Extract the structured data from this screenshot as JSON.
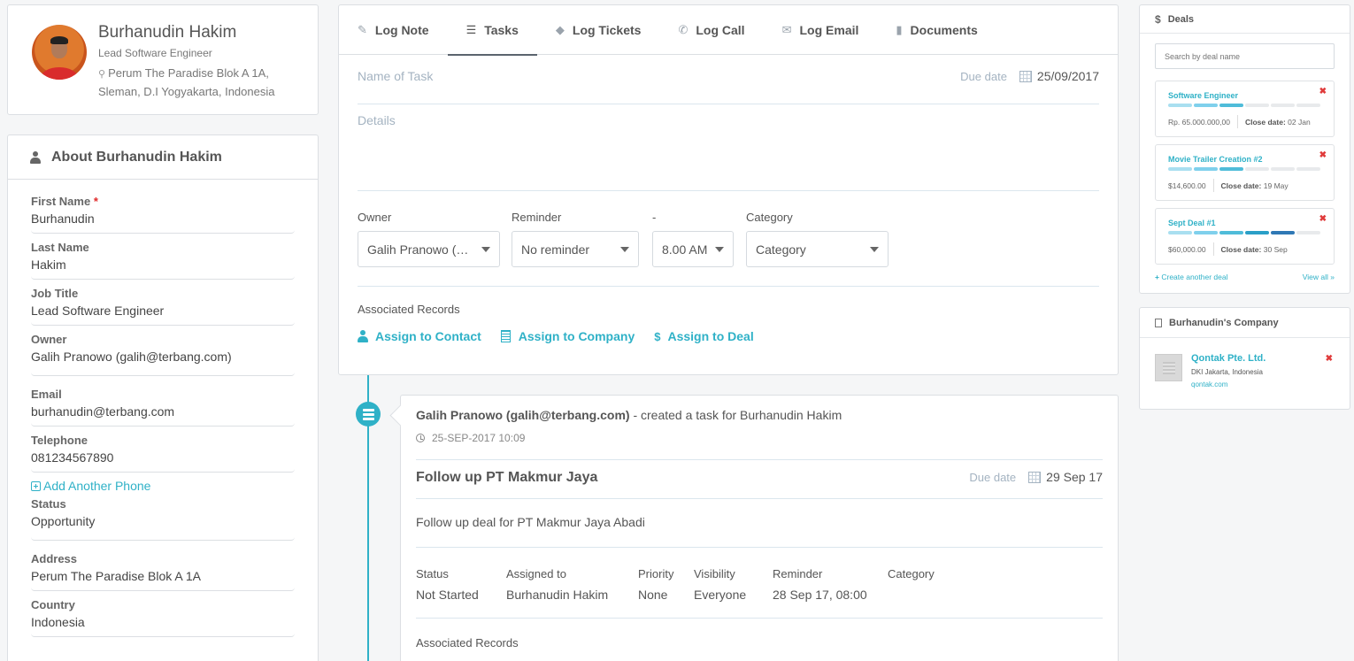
{
  "profile": {
    "name": "Burhanudin Hakim",
    "job_title": "Lead Software Engineer",
    "address_line1": "Perum The Paradise Blok A 1A,",
    "address_line2": "Sleman, D.I Yogyakarta, Indonesia"
  },
  "about": {
    "title": "About Burhanudin Hakim",
    "fields": [
      {
        "label": "First Name",
        "required": "*",
        "value": "Burhanudin"
      },
      {
        "label": "Last Name",
        "value": "Hakim"
      },
      {
        "label": "Job Title",
        "value": "Lead Software Engineer"
      },
      {
        "label": "Owner",
        "value": "Galih Pranowo (galih@terbang.com)"
      },
      {
        "label": "Email",
        "value": "burhanudin@terbang.com"
      },
      {
        "label": "Telephone",
        "value": "081234567890"
      },
      {
        "label": "Status",
        "value": "Opportunity"
      },
      {
        "label": "Address",
        "value": "Perum The Paradise Blok A 1A"
      },
      {
        "label": "Country",
        "value": "Indonesia"
      }
    ],
    "add_phone_label": "Add Another Phone"
  },
  "composer": {
    "tabs": [
      {
        "label": "Log Note",
        "icon": "edit-icon"
      },
      {
        "label": "Tasks",
        "icon": "tasks-icon",
        "active": true
      },
      {
        "label": "Log Tickets",
        "icon": "tag-icon"
      },
      {
        "label": "Log Call",
        "icon": "phone-icon"
      },
      {
        "label": "Log Email",
        "icon": "envelope-icon"
      },
      {
        "label": "Documents",
        "icon": "document-icon"
      }
    ],
    "task_name_placeholder": "Name of Task",
    "due_label": "Due date",
    "due_value": "25/09/2017",
    "details_placeholder": "Details",
    "owner": {
      "label": "Owner",
      "value": "Galih Pranowo (…"
    },
    "reminder": {
      "label": "Reminder",
      "value": "No reminder"
    },
    "time": {
      "label": "-",
      "value": "8.00 AM"
    },
    "category": {
      "label": "Category",
      "value": "Category"
    },
    "associated_label": "Associated Records",
    "assign_contact": "Assign to Contact",
    "assign_company": "Assign to Company",
    "assign_deal": "Assign to Deal"
  },
  "activity": {
    "actor": "Galih Pranowo (galih@terbang.com)",
    "action": " - created a task for Burhanudin Hakim",
    "timestamp": "25-SEP-2017 10:09",
    "title": "Follow up PT Makmur Jaya",
    "due_label": "Due date",
    "due_value": "29 Sep 17",
    "description": "Follow up deal for PT Makmur Jaya Abadi",
    "meta": [
      {
        "header": "Status",
        "value": "Not Started"
      },
      {
        "header": "Assigned to",
        "value": "Burhanudin Hakim"
      },
      {
        "header": "Priority",
        "value": "None"
      },
      {
        "header": "Visibility",
        "value": "Everyone"
      },
      {
        "header": "Reminder",
        "value": "28 Sep 17, 08:00"
      },
      {
        "header": "Category",
        "value": ""
      }
    ],
    "associated_label": "Associated Records"
  },
  "deals": {
    "title": "Deals",
    "search_placeholder": "Search by deal name",
    "stage_colors": [
      "#a9dff0",
      "#7fd0ec",
      "#4fbcd9",
      "#2a9fc7",
      "#2f78b5",
      "#e8eaec"
    ],
    "items": [
      {
        "name": "Software Engineer",
        "amount": "Rp. 65.000.000,00",
        "close_label": "Close date:",
        "close_date": "02 Jan",
        "stages_completed": 3,
        "stages_total": 6
      },
      {
        "name": "Movie Trailer Creation #2",
        "amount": "$14,600.00",
        "close_label": "Close date:",
        "close_date": "19 May",
        "stages_completed": 3,
        "stages_total": 6
      },
      {
        "name": "Sept Deal #1",
        "amount": "$60,000.00",
        "close_label": "Close date:",
        "close_date": "30 Sep",
        "stages_completed": 5,
        "stages_total": 6
      }
    ],
    "create_label": "Create another deal",
    "view_all_label": "View all »"
  },
  "company": {
    "title": "Burhanudin's Company",
    "name": "Qontak Pte. Ltd.",
    "location": "DKI Jakarta, Indonesia",
    "website": "qontak.com"
  }
}
